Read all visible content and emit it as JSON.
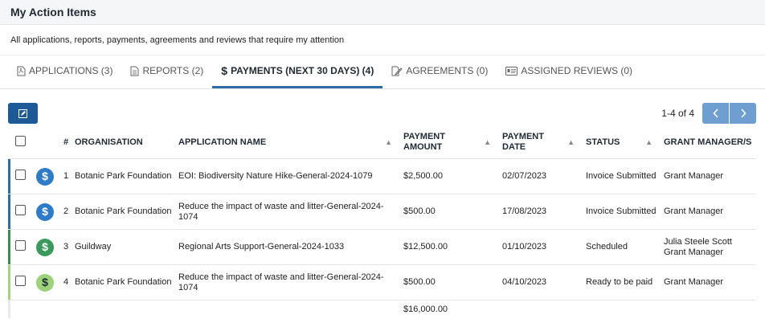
{
  "header": {
    "title": "My Action Items"
  },
  "subtitle": "All applications, reports, payments, agreements and reviews that require my attention",
  "tabs": [
    {
      "label": "APPLICATIONS (3)",
      "icon": "pdf-file-icon"
    },
    {
      "label": "REPORTS (2)",
      "icon": "document-icon"
    },
    {
      "label": "PAYMENTS (NEXT 30 DAYS) (4)",
      "icon": "dollar-icon",
      "active": true
    },
    {
      "label": "AGREEMENTS (0)",
      "icon": "signature-icon"
    },
    {
      "label": "ASSIGNED REVIEWS (0)",
      "icon": "id-card-icon"
    }
  ],
  "pager": {
    "range": "1-4 of 4"
  },
  "table": {
    "columns": {
      "num": "#",
      "organisation": "ORGANISATION",
      "application": "APPLICATION NAME",
      "amount": "PAYMENT AMOUNT",
      "date": "PAYMENT DATE",
      "status": "STATUS",
      "manager": "GRANT MANAGER/S"
    },
    "rows": [
      {
        "num": "1",
        "organisation": "Botanic Park Foundation",
        "application": "EOI: Biodiversity Nature Hike-General-2024-1079",
        "amount": "$2,500.00",
        "date": "02/07/2023",
        "status": "Invoice Submitted",
        "manager": "Grant Manager",
        "accent_color": "#2e6da4",
        "icon_bg": "#2e7bc7",
        "icon_fg": "#ffffff"
      },
      {
        "num": "2",
        "organisation": "Botanic Park Foundation",
        "application": "Reduce the impact of waste and litter-General-2024-1074",
        "amount": "$500.00",
        "date": "17/08/2023",
        "status": "Invoice Submitted",
        "manager": "Grant Manager",
        "accent_color": "#2e6da4",
        "icon_bg": "#2e7bc7",
        "icon_fg": "#ffffff"
      },
      {
        "num": "3",
        "organisation": "Guildway",
        "application": "Regional Arts Support-General-2024-1033",
        "amount": "$12,500.00",
        "date": "01/10/2023",
        "status": "Scheduled",
        "manager": "Julia Steele Scott Grant Manager",
        "accent_color": "#3a8a55",
        "icon_bg": "#3a9a5c",
        "icon_fg": "#ffffff"
      },
      {
        "num": "4",
        "organisation": "Botanic Park Foundation",
        "application": "Reduce the impact of waste and litter-General-2024-1074",
        "amount": "$500.00",
        "date": "04/10/2023",
        "status": "Ready to be paid",
        "manager": "Grant Manager",
        "accent_color": "#a6d37e",
        "icon_bg": "#9dd27a",
        "icon_fg": "#1f2a36"
      }
    ],
    "total": "$16,000.00"
  },
  "colors": {
    "tab_active_underline": "#2e6da4",
    "edit_button": "#1e5b96",
    "pager_button": "#6f9fd0"
  }
}
